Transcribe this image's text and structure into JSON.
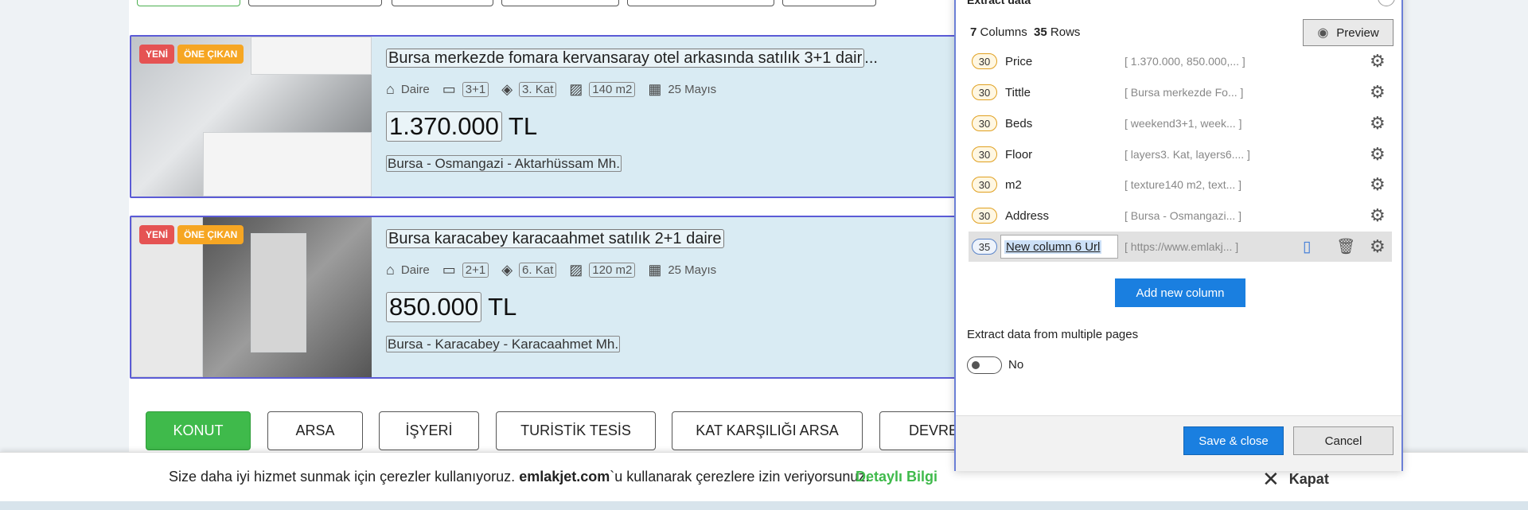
{
  "listings": [
    {
      "badge_new": "YENİ",
      "badge_featured": "ÖNE ÇIKAN",
      "title": "Bursa merkezde fomara kervansaray otel arkasında satılık 3+1 dair",
      "title_suffix": "...",
      "type": "Daire",
      "rooms": "3+1",
      "floor": "3. Kat",
      "area": "140 m2",
      "date": "25 Mayıs",
      "price": "1.370.000",
      "currency": "TL",
      "address": "Bursa - Osmangazi - Aktarhüssam Mh."
    },
    {
      "badge_new": "YENİ",
      "badge_featured": "ÖNE ÇIKAN",
      "title": "Bursa karacabey karacaahmet satılık 2+1 daire",
      "title_suffix": "",
      "type": "Daire",
      "rooms": "2+1",
      "floor": "6. Kat",
      "area": "120 m2",
      "date": "25 Mayıs",
      "price": "850.000",
      "currency": "TL",
      "address": "Bursa - Karacabey - Karacaahmet Mh."
    }
  ],
  "categories": [
    "KONUT",
    "ARSA",
    "İŞYERİ",
    "TURİSTİK TESİS",
    "KAT KARŞILIĞI ARSA",
    "DEVREN"
  ],
  "cookie": {
    "text_before": "Size daha iyi hizmet sunmak için çerezler kullanıyoruz. ",
    "site": "emlakjet.com",
    "text_after": "`u kullanarak çerezlere izin veriyorsunuz.",
    "more": "Detaylı Bilgi",
    "close": "Kapat"
  },
  "panel": {
    "title": "Extract data",
    "columns_count": "7",
    "columns_label": "Columns",
    "rows_count": "35",
    "rows_label": "Rows",
    "preview": "Preview",
    "columns": [
      {
        "count": "30",
        "name": "Price",
        "sample": "[ 1.370.000, 850.000,...   ]"
      },
      {
        "count": "30",
        "name": "Tittle",
        "sample": "[ Bursa merkezde Fo...   ]"
      },
      {
        "count": "30",
        "name": "Beds",
        "sample": "[ weekend3+1, week...   ]"
      },
      {
        "count": "30",
        "name": "Floor",
        "sample": "[ layers3. Kat, layers6....  ]"
      },
      {
        "count": "30",
        "name": "m2",
        "sample": "[ texture140 m2, text...   ]"
      },
      {
        "count": "30",
        "name": "Address",
        "sample": "[ Bursa - Osmangazi...   ]"
      },
      {
        "count": "35",
        "name": "New column 6 Url",
        "sample": "[ https://www.emlakj...   ]"
      }
    ],
    "add_column": "Add new column",
    "multi_pages_label": "Extract data from multiple pages",
    "multi_pages_value": "No",
    "save": "Save & close",
    "cancel": "Cancel"
  },
  "colors": {
    "accent_blue": "#1a7fe0",
    "category_active": "#3fba4b",
    "badge_new": "#e55353",
    "badge_featured": "#f6a623",
    "card_border": "#5b5bd6"
  }
}
